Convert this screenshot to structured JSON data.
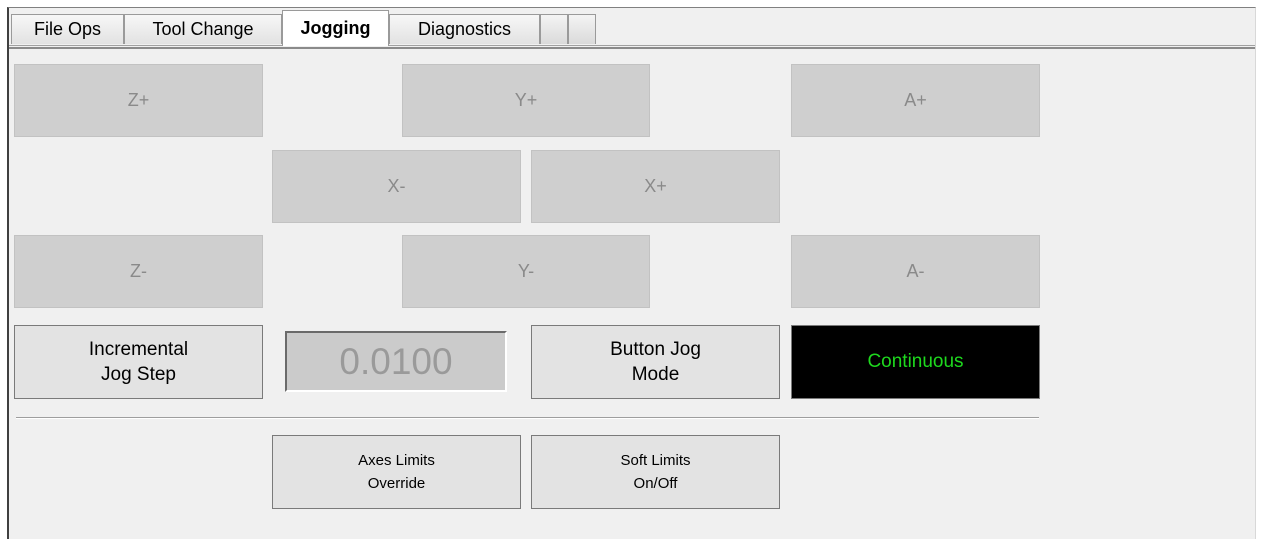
{
  "tabs": [
    {
      "label": "File Ops",
      "active": false
    },
    {
      "label": "Tool Change",
      "active": false
    },
    {
      "label": "Jogging",
      "active": true
    },
    {
      "label": "Diagnostics",
      "active": false
    },
    {
      "label": "",
      "active": false
    },
    {
      "label": "",
      "active": false
    }
  ],
  "jog_buttons": {
    "z_plus": "Z+",
    "y_plus": "Y+",
    "a_plus": "A+",
    "x_minus": "X-",
    "x_plus": "X+",
    "z_minus": "Z-",
    "y_minus": "Y-",
    "a_minus": "A-"
  },
  "controls": {
    "incremental_jog_step_label": "Incremental\nJog Step",
    "jog_step_value": "0.0100",
    "button_jog_mode_label": "Button Jog\nMode",
    "jog_mode_value": "Continuous",
    "axes_limits_override_label": "Axes Limits\nOverride",
    "soft_limits_label": "Soft Limits\nOn/Off"
  },
  "colors": {
    "jog_mode_text": "#1ed81e",
    "jog_mode_background": "#000000",
    "jog_button_background": "#cfcfcf",
    "panel_background": "#f0f0f0"
  }
}
